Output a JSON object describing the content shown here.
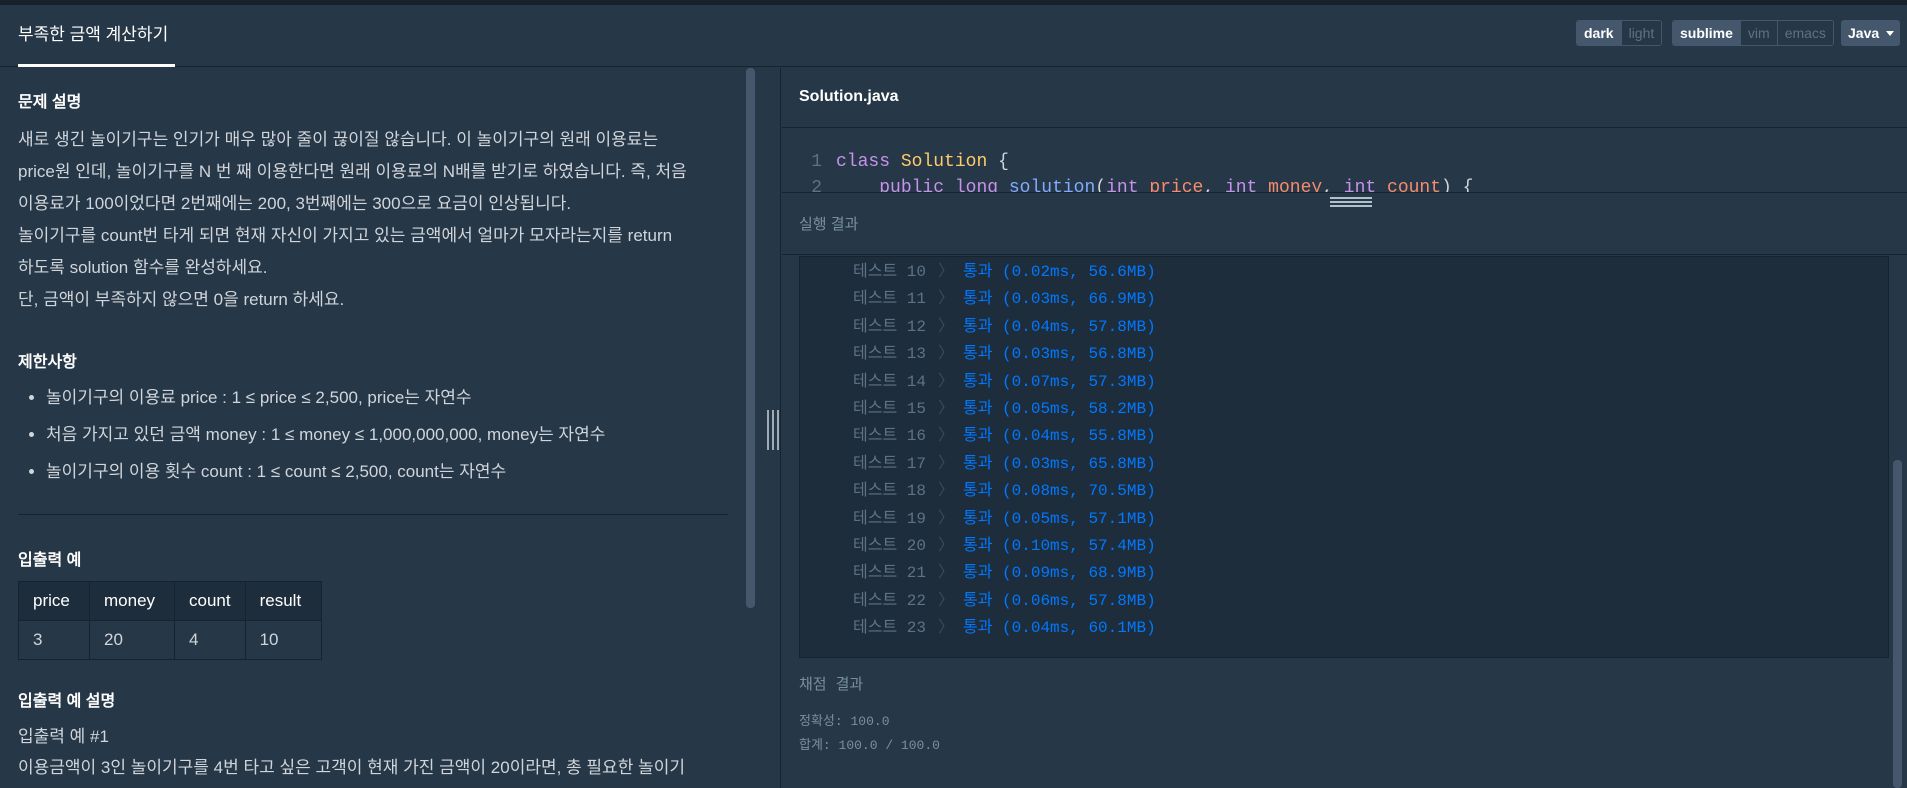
{
  "header": {
    "title": "부족한 금액 계산하기",
    "theme_options": [
      {
        "label": "dark",
        "active": true
      },
      {
        "label": "light",
        "active": false
      }
    ],
    "keymap_options": [
      {
        "label": "sublime",
        "active": true
      },
      {
        "label": "vim",
        "active": false
      },
      {
        "label": "emacs",
        "active": false
      }
    ],
    "language": "Java"
  },
  "problem": {
    "desc_heading": "문제 설명",
    "desc_lines": [
      "새로 생긴 놀이기구는 인기가 매우 많아 줄이 끊이질 않습니다. 이 놀이기구의 원래 이용료는",
      "price원 인데, 놀이기구를 N 번 째 이용한다면 원래 이용료의 N배를 받기로 하였습니다. 즉, 처음",
      "이용료가 100이었다면 2번째에는 200, 3번째에는 300으로 요금이 인상됩니다.",
      "놀이기구를 count번 타게 되면 현재 자신이 가지고 있는 금액에서 얼마가 모자라는지를 return",
      "하도록 solution 함수를 완성하세요.",
      "단, 금액이 부족하지 않으면 0을 return 하세요."
    ],
    "constraints_heading": "제한사항",
    "constraints": [
      "놀이기구의 이용료 price : 1 ≤ price ≤ 2,500, price는 자연수",
      "처음 가지고 있던 금액 money : 1 ≤ money ≤ 1,000,000,000, money는 자연수",
      "놀이기구의 이용 횟수 count : 1 ≤ count ≤ 2,500, count는 자연수"
    ],
    "io_heading": "입출력 예",
    "io_table": {
      "headers": [
        "price",
        "money",
        "count",
        "result"
      ],
      "rows": [
        [
          "3",
          "20",
          "4",
          "10"
        ]
      ]
    },
    "io_desc_heading": "입출력 예 설명",
    "io_example_label": "입출력 예 #1",
    "io_example_text": "이용금액이 3인 놀이기구를 4번 타고 싶은 고객이 현재 가진 금액이 20이라면, 총 필요한 놀이기"
  },
  "editor": {
    "file_name": "Solution.java",
    "line1_num": "1",
    "line1_kw": "class",
    "line1_cls": "Solution",
    "line1_brace": "{",
    "line2_num": "2",
    "line2_code_a": "public",
    "line2_code_b": "long",
    "line2_fn": "solution",
    "line2_t1": "int",
    "line2_p1": "price",
    "line2_t2": "int",
    "line2_p2": "money",
    "line2_t3": "int",
    "line2_p3": "count"
  },
  "results": {
    "title": "실행 결과",
    "rows": [
      {
        "label": "테스트 10",
        "status": "통과 (0.02ms, 56.6MB)"
      },
      {
        "label": "테스트 11",
        "status": "통과 (0.03ms, 66.9MB)"
      },
      {
        "label": "테스트 12",
        "status": "통과 (0.04ms, 57.8MB)"
      },
      {
        "label": "테스트 13",
        "status": "통과 (0.03ms, 56.8MB)"
      },
      {
        "label": "테스트 14",
        "status": "통과 (0.07ms, 57.3MB)"
      },
      {
        "label": "테스트 15",
        "status": "통과 (0.05ms, 58.2MB)"
      },
      {
        "label": "테스트 16",
        "status": "통과 (0.04ms, 55.8MB)"
      },
      {
        "label": "테스트 17",
        "status": "통과 (0.03ms, 65.8MB)"
      },
      {
        "label": "테스트 18",
        "status": "통과 (0.08ms, 70.5MB)"
      },
      {
        "label": "테스트 19",
        "status": "통과 (0.05ms, 57.1MB)"
      },
      {
        "label": "테스트 20",
        "status": "통과 (0.10ms, 57.4MB)"
      },
      {
        "label": "테스트 21",
        "status": "통과 (0.09ms, 68.9MB)"
      },
      {
        "label": "테스트 22",
        "status": "통과 (0.06ms, 57.8MB)"
      },
      {
        "label": "테스트 23",
        "status": "통과 (0.04ms, 60.1MB)"
      }
    ]
  },
  "grading": {
    "title": "채점 결과",
    "accuracy": "정확성: 100.0",
    "total": "합계: 100.0 / 100.0"
  }
}
